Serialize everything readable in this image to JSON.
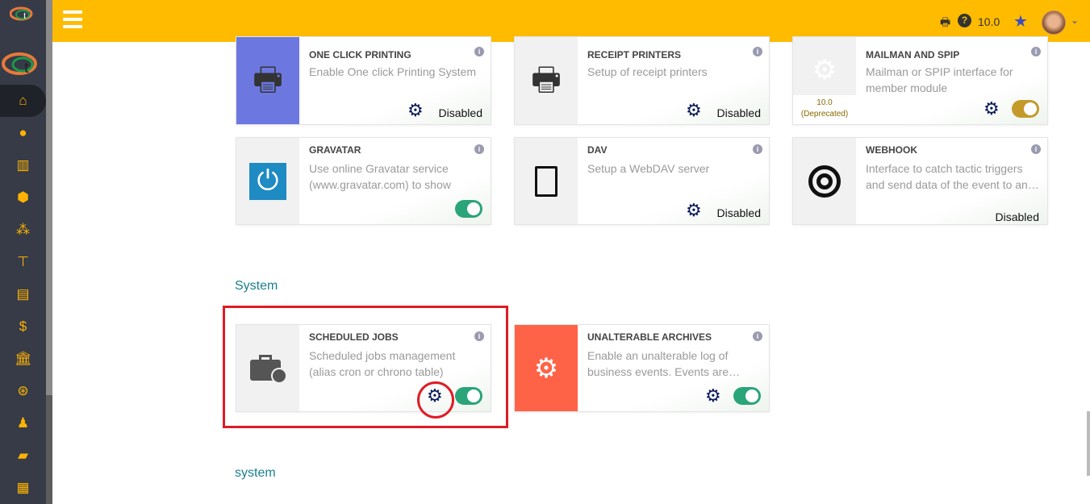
{
  "sidebar": {
    "items": [
      "home-icon",
      "user-icon",
      "building-icon",
      "box-icon",
      "cubes-icon",
      "hierarchy-icon",
      "briefcase-icon",
      "invoice-icon",
      "bank-icon",
      "search-dollar-icon",
      "user-tie-icon",
      "folder-open-icon",
      "calendar-icon"
    ]
  },
  "topbar": {
    "version": "10.0"
  },
  "cards": [
    {
      "title": "ONE CLICK PRINTING",
      "desc": "Enable One click Printing System",
      "status": "Disabled",
      "icon": "printer-icon"
    },
    {
      "title": "RECEIPT PRINTERS",
      "desc": "Setup of receipt printers",
      "status": "Disabled",
      "icon": "printer-icon"
    },
    {
      "title": "MAILMAN AND SPIP",
      "desc": "Mailman or SPIP interface for member module",
      "version": "10.0",
      "deprecated": "(Deprecated)",
      "icon": "cogs-icon",
      "enabled": true
    },
    {
      "title": "GRAVATAR",
      "desc": "Use online Gravatar service (www.gravatar.com) to show phot…",
      "icon": "power-icon",
      "enabled": true
    },
    {
      "title": "DAV",
      "desc": "Setup a WebDAV server",
      "status": "Disabled",
      "icon": "file-icon"
    },
    {
      "title": "WEBHOOK",
      "desc": "Interface to catch tactic triggers and send data of the event to an…",
      "status": "Disabled",
      "icon": "target-icon"
    },
    {
      "title": "SCHEDULED JOBS",
      "desc": "Scheduled jobs management (alias cron or chrono table)",
      "icon": "briefcase-clock-icon",
      "enabled": true
    },
    {
      "title": "UNALTERABLE ARCHIVES",
      "desc": "Enable an unalterable log of business events. Events are…",
      "icon": "cogs-icon",
      "enabled": true
    }
  ],
  "sections": {
    "system": "System",
    "system2": "system"
  },
  "colors": {
    "topbar": "#ffbb00",
    "sidebar": "#363b47",
    "toggle_on": "#2aa57a",
    "highlight": "#e01b24"
  }
}
